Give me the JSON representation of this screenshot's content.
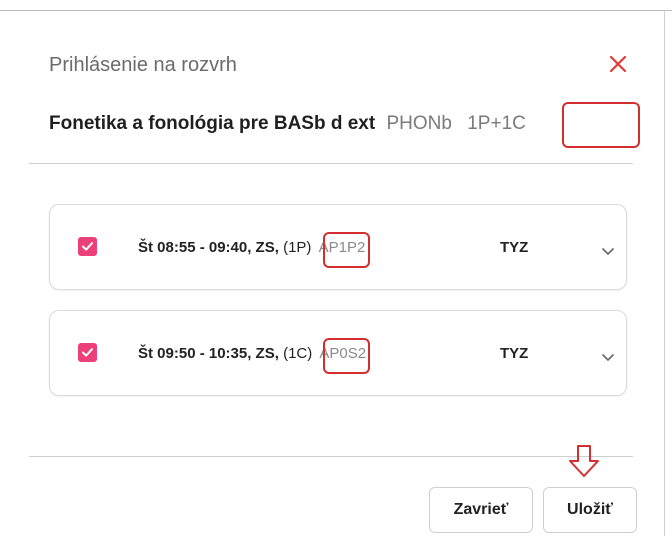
{
  "dialog": {
    "title": "Prihlásenie na rozvrh",
    "course_name": "Fonetika a fonológia pre BASb d ext",
    "course_code": "PHONb",
    "course_hours": "1P+1C",
    "close_icon": "close-icon"
  },
  "slots": [
    {
      "checked": true,
      "time": "Št 08:55 - 09:40, ZS,",
      "type": "(1P)",
      "room": "AP1P2",
      "teacher": "TYZ",
      "expand_icon": "chevron-down-icon"
    },
    {
      "checked": true,
      "time": "Št 09:50 - 10:35, ZS,",
      "type": "(1C)",
      "room": "AP0S2",
      "teacher": "TYZ",
      "expand_icon": "chevron-down-icon"
    }
  ],
  "footer": {
    "close_label": "Zavrieť",
    "save_label": "Uložiť"
  },
  "colors": {
    "accent": "#ec407a",
    "annotation": "#d32f2f"
  }
}
